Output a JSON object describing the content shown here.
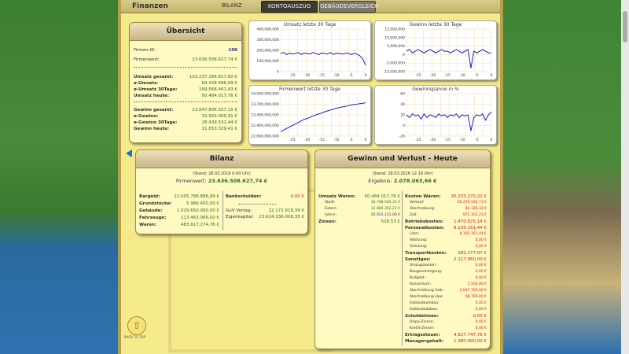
{
  "header": {
    "title": "Finanzen",
    "tab_bilanz": "BILANZ",
    "tab_konto": "KONTOAUSZUG",
    "tab_gebaeude": "GEBÄUDEVERGLEICH"
  },
  "uebersicht": {
    "title": "Übersicht",
    "firmen_id_label": "Firmen-ID:",
    "firmen_id": "106",
    "firmenwert_label": "Firmenwert:",
    "firmenwert": "23.636.508.627,74 €",
    "rows": [
      {
        "label": "Umsatz gesamt:",
        "value": "103.237.184.617,60 €"
      },
      {
        "label": "ø-Umsatz:",
        "value": "69.428.486,09 €"
      },
      {
        "label": "ø-Umsatz 30Tage:",
        "value": "169.568.461,43 €"
      },
      {
        "label": "Umsatz heute:",
        "value": "50.484.017,76 €"
      },
      {
        "label": "Gewinn gesamt:",
        "value": "23.647.806.557,15 €"
      },
      {
        "label": "ø-Gewinn:",
        "value": "15.903.000,91 €"
      },
      {
        "label": "ø-Gewinn 30Tage:",
        "value": "28.439.531,44 €"
      },
      {
        "label": "Gewinn heute:",
        "value": "11.653.329,41 €"
      }
    ]
  },
  "charts": [
    {
      "title": "Umsatz letzte 30 Tage",
      "yticks": [
        "400,000,000",
        "300,000,000",
        "200,000,000",
        "100,000,000",
        "0"
      ],
      "xticks": [
        "-25",
        "-20",
        "-15",
        "-10",
        "-5",
        "0"
      ]
    },
    {
      "title": "Gewinn letzte 30 Tage",
      "yticks": [
        "15,000,000",
        "10,000,000",
        "5,000,000",
        "0",
        "-5,000,000",
        "-10,000,000"
      ],
      "xticks": [
        "-25",
        "-20",
        "-15",
        "-10",
        "-5",
        "0"
      ]
    },
    {
      "title": "Firmenwert letzte 30 Tage",
      "yticks": [
        "24,000,000,000",
        "23,700,000,000",
        "23,400,000,000",
        "22,900,000,000",
        "22,600,000,000"
      ],
      "xticks": [
        "-25",
        "-20",
        "-15",
        "-10",
        "-5",
        "0"
      ]
    },
    {
      "title": "Gewinnspanne in %",
      "yticks": [
        "60",
        "40",
        "20",
        "0",
        "-20"
      ],
      "xticks": [
        "-25",
        "-20",
        "-15",
        "-10",
        "-5",
        "0"
      ]
    }
  ],
  "chart_data": [
    {
      "type": "line",
      "title": "Umsatz letzte 30 Tage",
      "x": [
        -29,
        -28,
        -27,
        -26,
        -25,
        -24,
        -23,
        -22,
        -21,
        -20,
        -19,
        -18,
        -17,
        -16,
        -15,
        -14,
        -13,
        -12,
        -11,
        -10,
        -9,
        -8,
        -7,
        -6,
        -5,
        -4,
        -3,
        -2,
        -1,
        0
      ],
      "values": [
        170,
        180,
        160,
        175,
        165,
        170,
        180,
        160,
        175,
        170,
        165,
        180,
        170,
        160,
        175,
        170,
        165,
        180,
        160,
        175,
        170,
        165,
        170,
        175,
        160,
        170,
        165,
        150,
        120,
        60
      ],
      "ylim": [
        0,
        400
      ]
    },
    {
      "type": "line",
      "title": "Gewinn letzte 30 Tage",
      "x": [
        -29,
        -28,
        -27,
        -26,
        -25,
        -24,
        -23,
        -22,
        -21,
        -20,
        -19,
        -18,
        -17,
        -16,
        -15,
        -14,
        -13,
        -12,
        -11,
        -10,
        -9,
        -8,
        -7,
        -6,
        -5,
        -4,
        -3,
        -2,
        -1,
        0
      ],
      "values": [
        2,
        3,
        1,
        2,
        3,
        2,
        1,
        2,
        3,
        2,
        1,
        2,
        3,
        2,
        2,
        1,
        2,
        3,
        2,
        1,
        2,
        3,
        -8,
        2,
        1,
        2,
        3,
        2,
        1,
        1
      ],
      "ylim": [
        -10,
        15
      ]
    },
    {
      "type": "line",
      "title": "Firmenwert letzte 30 Tage",
      "x": [
        -29,
        -28,
        -27,
        -26,
        -25,
        -24,
        -23,
        -22,
        -21,
        -20,
        -19,
        -18,
        -17,
        -16,
        -15,
        -14,
        -13,
        -12,
        -11,
        -10,
        -9,
        -8,
        -7,
        -6,
        -5,
        -4,
        -3,
        -2,
        -1,
        0
      ],
      "values": [
        22.75,
        22.8,
        22.85,
        22.9,
        22.95,
        23.0,
        23.05,
        23.1,
        23.15,
        23.18,
        23.22,
        23.26,
        23.3,
        23.33,
        23.36,
        23.4,
        23.43,
        23.46,
        23.49,
        23.52,
        23.54,
        23.56,
        23.58,
        23.6,
        23.62,
        23.64,
        23.65,
        23.67,
        23.68,
        23.7
      ],
      "ylim": [
        22.6,
        24.0
      ]
    },
    {
      "type": "line",
      "title": "Gewinnspanne in %",
      "x": [
        -29,
        -28,
        -27,
        -26,
        -25,
        -24,
        -23,
        -22,
        -21,
        -20,
        -19,
        -18,
        -17,
        -16,
        -15,
        -14,
        -13,
        -12,
        -11,
        -10,
        -9,
        -8,
        -7,
        -6,
        -5,
        -4,
        -3,
        -2,
        -1,
        0
      ],
      "values": [
        20,
        15,
        22,
        18,
        20,
        12,
        22,
        15,
        20,
        18,
        15,
        22,
        18,
        20,
        15,
        20,
        18,
        22,
        15,
        20,
        18,
        20,
        -10,
        15,
        20,
        18,
        22,
        10,
        20,
        25
      ],
      "ylim": [
        -20,
        60
      ]
    }
  ],
  "bilanz": {
    "title": "Bilanz",
    "stand": "(Stand: 28.03.2016 0:00 Uhr)",
    "firmenwert_label": "Firmenwert:",
    "firmenwert": "23.636.508.627,74 €",
    "aktiva": [
      {
        "label": "Bargeld:",
        "value": "22.005.788.886,99 €"
      },
      {
        "label": "Grundstücke:",
        "value": "5.989.400,00 €"
      },
      {
        "label": "Gebäude:",
        "value": "1.029.650.000,00 €"
      },
      {
        "label": "Fahrzeuge:",
        "value": "113.463.066,00 €"
      },
      {
        "label": "Waren:",
        "value": "483.617.274,76 €"
      }
    ],
    "passiva": [
      {
        "label": "Bankschulden:",
        "value": "0,00 €"
      },
      {
        "label": "GuV Vortag:",
        "value": "12.172.619,39 €"
      },
      {
        "label": "Eigenkapital:",
        "value": "23.624.336.008,35 €"
      }
    ]
  },
  "guv": {
    "title": "Gewinn und Verlust - Heute",
    "stand": "(Stand: 28.03.2016 12:19 Uhr)",
    "ergebnis_label": "Ergebnis:",
    "ergebnis": "2.078.063,66 €",
    "left": [
      {
        "label": "Umsatz Waren:",
        "value": "50.484.017,76 €"
      },
      {
        "label": "Stadt:",
        "value": "16.768.504,31 €"
      },
      {
        "label": "Extern:",
        "value": "12.884.362,21 €"
      },
      {
        "label": "Intern:",
        "value": "20.931.151,00 €"
      },
      {
        "label": "Zinsen:",
        "value": "528,53 €"
      }
    ],
    "right": [
      {
        "label": "Kosten Waren:",
        "value": "30.233.270,22 €"
      },
      {
        "label": "Verkauf:",
        "value": "29.279.593,71 €"
      },
      {
        "label": "Abschreibung:",
        "value": "84.326,32 €"
      },
      {
        "label": "Zoll:",
        "value": "875.303,21 €"
      },
      {
        "label": "Betriebskosten:",
        "value": "1.470.825,14 €"
      },
      {
        "label": "Personalkosten:",
        "value": "8.105.161,44 €"
      },
      {
        "label": "Lohn:",
        "value": "8.105.161,44 €"
      },
      {
        "label": "Ablösung:",
        "value": "0,00 €"
      },
      {
        "label": "Schulung:",
        "value": "0,00 €"
      },
      {
        "label": "Transportkosten:",
        "value": "282.277,97 €"
      },
      {
        "label": "Sonstiges:",
        "value": "2.117.960,00 €"
      },
      {
        "label": "Umzugskosten:",
        "value": "0,00 €"
      },
      {
        "label": "Baugenehmigung:",
        "value": "0,00 €"
      },
      {
        "label": "Bußgeld:",
        "value": "0,00 €"
      },
      {
        "label": "Konsortium:",
        "value": "1.500,00 €"
      },
      {
        "label": "Abschreibung Geb.:",
        "value": "2.047.700,00 €"
      },
      {
        "label": "Abschreibung Lkw:",
        "value": "68.760,00 €"
      },
      {
        "label": "Gebäudeumbau:",
        "value": "0,00 €"
      },
      {
        "label": "Gebäudeabbau:",
        "value": "0,00 €"
      },
      {
        "label": "Schuldzinsen:",
        "value": "0,00 €"
      },
      {
        "label": "Dispo-Zinsen:",
        "value": "0,00 €"
      },
      {
        "label": "Kredit-Zinsen:",
        "value": "0,00 €"
      },
      {
        "label": "Ertragssteuer:",
        "value": "4.627.747,76 €"
      },
      {
        "label": "Managergehalt:",
        "value": "1.380.000,00 €"
      }
    ]
  },
  "back_label": "BACK TO TOP"
}
